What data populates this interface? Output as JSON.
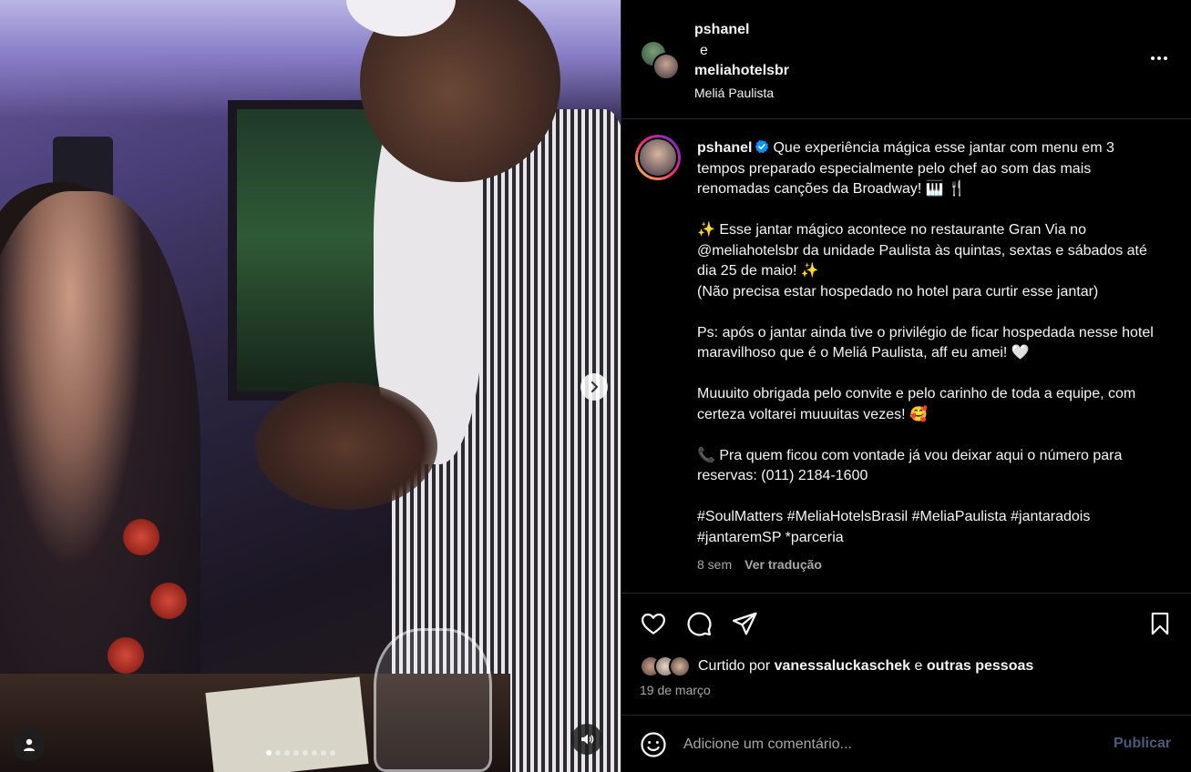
{
  "header": {
    "user1": "pshanel",
    "connector": "e",
    "user2": "meliahotelsbr",
    "location": "Meliá Paulista"
  },
  "caption": {
    "username": "pshanel",
    "text": "Que experiência mágica esse jantar com menu em 3 tempos preparado especialmente pelo chef ao som das mais renomadas canções da Broadway! 🎹 🍴\n\n✨ Esse jantar mágico acontece no restaurante Gran Via no @meliahotelsbr da unidade Paulista às quintas, sextas e sábados até dia 25 de maio! ✨\n(Não precisa estar hospedado no hotel para curtir esse jantar)\n\nPs: após o jantar ainda tive o privilégio de ficar hospedada nesse hotel maravilhoso que é o Meliá Paulista, aff eu amei! 🤍\n\nMuuuito obrigada pelo convite e pelo carinho de toda a equipe, com certeza voltarei muuuitas vezes! 🥰\n\n📞 Pra quem ficou com vontade já vou deixar aqui o número para reservas: (011) 2184-1600\n\n#SoulMatters #MeliaHotelsBrasil #MeliaPaulista #jantaradois #jantaremSP *parceria",
    "time": "8 sem",
    "translate": "Ver tradução"
  },
  "likes": {
    "prefix": "Curtido por",
    "user": "vanessaluckaschek",
    "connector": "e",
    "others": "outras pessoas"
  },
  "date": "19 de março",
  "comment": {
    "placeholder": "Adicione um comentário...",
    "publish": "Publicar"
  },
  "carousel": {
    "total": 8,
    "current": 0
  },
  "colors": {
    "verified": "#0095f6",
    "muted": "#a8a8a8",
    "publish_disabled": "#4a5a7a"
  }
}
